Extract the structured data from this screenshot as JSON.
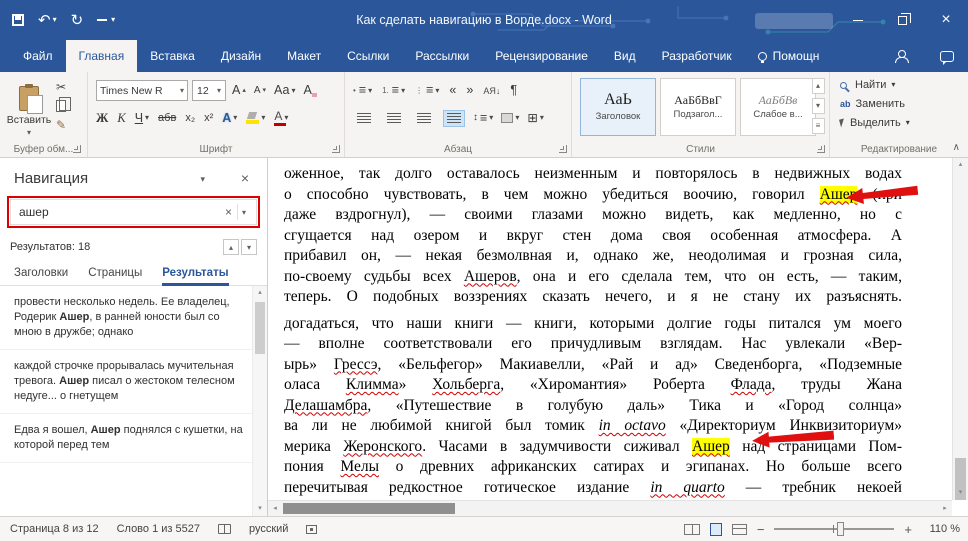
{
  "icons": {
    "dropdown": "▾",
    "undo": "↶",
    "redo": "↻",
    "close": "×",
    "cut": "✂",
    "brush": "✎",
    "pilcrow": "¶",
    "list": "≡",
    "outdent": "«",
    "indent": "»",
    "sort": "АЯ↓",
    "updown": "↕",
    "borders": "⊞",
    "up": "▴",
    "down": "▾",
    "left": "◂",
    "right": "▸",
    "collapse": "∧",
    "clear_x": "×",
    "zoom_out": "−",
    "zoom_in": "+"
  },
  "title_bar": {
    "title": "Как сделать навигацию в Ворде.docx - Word"
  },
  "ribbon": {
    "tabs": [
      {
        "label": "Файл",
        "active": false
      },
      {
        "label": "Главная",
        "active": true
      },
      {
        "label": "Вставка",
        "active": false
      },
      {
        "label": "Дизайн",
        "active": false
      },
      {
        "label": "Макет",
        "active": false
      },
      {
        "label": "Ссылки",
        "active": false
      },
      {
        "label": "Рассылки",
        "active": false
      },
      {
        "label": "Рецензирование",
        "active": false
      },
      {
        "label": "Вид",
        "active": false
      },
      {
        "label": "Разработчик",
        "active": false
      },
      {
        "label": "Помощн",
        "active": false,
        "assistant": true
      }
    ],
    "clipboard": {
      "label": "Буфер обм...",
      "paste": "Вставить"
    },
    "font": {
      "label": "Шрифт",
      "name": "Times New R",
      "size": "12",
      "grow": "А",
      "shrink": "А",
      "case_btn": "Аа",
      "clear": "А",
      "bold": "Ж",
      "italic": "К",
      "underline": "Ч",
      "strike": "абв",
      "subscript": "х₂",
      "superscript": "х²",
      "effects": "А",
      "color": "А"
    },
    "paragraph": {
      "label": "Абзац"
    },
    "styles": {
      "label": "Стили",
      "items": [
        {
          "preview": "АаЬ",
          "name": "Заголовок"
        },
        {
          "preview": "АаБбВвГ",
          "name": "Подзагол..."
        },
        {
          "preview": "АаБбВв",
          "name": "Слабое в..."
        }
      ]
    },
    "editing": {
      "label": "Редактирование",
      "find": "Найти",
      "replace": "Заменить",
      "select": "Выделить"
    }
  },
  "navigation": {
    "title": "Навигация",
    "search_value": "ашер",
    "results_label": "Результатов: 18",
    "tabs": [
      {
        "label": "Заголовки",
        "active": false
      },
      {
        "label": "Страницы",
        "active": false
      },
      {
        "label": "Результаты",
        "active": true
      }
    ],
    "results": [
      {
        "segments": [
          {
            "t": "провести несколько недель. Ее владелец, Родерик "
          },
          {
            "t": "Ашер",
            "b": true
          },
          {
            "t": ", в ранней юности был со мною в дружбе; однако"
          }
        ]
      },
      {
        "segments": [
          {
            "t": "каждой строчке прорывалась мучительная тревога. "
          },
          {
            "t": "Ашер",
            "b": true
          },
          {
            "t": " писал о жестоком телесном недуге... о гнетущем"
          }
        ]
      },
      {
        "segments": [
          {
            "t": "Едва я вошел, "
          },
          {
            "t": "Ашер",
            "b": true
          },
          {
            "t": " поднялся с кушетки, на которой перед тем"
          }
        ]
      }
    ]
  },
  "document": {
    "lines": [
      {
        "segments": [
          {
            "t": "оженное, так долго оставалось неизменным и повторялось в недвижных водах"
          }
        ]
      },
      {
        "segments": [
          {
            "t": "о способно чувствовать, в чем можно убедиться воочию, говорил "
          },
          {
            "t": "Ашер",
            "h": true,
            "u": true
          },
          {
            "t": " (при"
          }
        ]
      },
      {
        "segments": [
          {
            "t": "даже вздрогнул), — своими глазами можно видеть, как медленно, но с"
          }
        ]
      },
      {
        "segments": [
          {
            "t": "сгущается над озером и вкруг стен дома своя особенная атмосфера. А"
          }
        ]
      },
      {
        "segments": [
          {
            "t": "прибавил он, — некая безмолвная и, однако же, неодолимая и грозная сила,"
          }
        ]
      },
      {
        "segments": [
          {
            "t": "по-своему судьбы всех "
          },
          {
            "t": "Ашеров",
            "u": true
          },
          {
            "t": ", она и его сделала тем, что он есть, — таким,"
          }
        ]
      },
      {
        "segments": [
          {
            "t": "теперь. О подобных воззрениях сказать нечего, и я не стану их разъяснять."
          }
        ]
      },
      {
        "para": true,
        "segments": [
          {
            "t": "догадаться, что наши книги — книги, которыми долгие годы питался ум моего"
          }
        ]
      },
      {
        "segments": [
          {
            "t": "— вполне соответствовали его причудливым взглядам. Нас увлекали «Вер-"
          }
        ]
      },
      {
        "segments": [
          {
            "t": "ырь» "
          },
          {
            "t": "Грессэ",
            "u": true
          },
          {
            "t": ", «Бельфегор» Макиавелли, «Рай и ад» Сведенборга, «Подземные"
          }
        ]
      },
      {
        "segments": [
          {
            "t": "оласа "
          },
          {
            "t": "Климма",
            "u": true
          },
          {
            "t": "» "
          },
          {
            "t": "Хольберга",
            "u": true
          },
          {
            "t": ", «Хиромантия» Роберта "
          },
          {
            "t": "Флада",
            "u": true
          },
          {
            "t": ", труды Жана"
          }
        ]
      },
      {
        "segments": [
          {
            "t": "Делашамбра",
            "u": true
          },
          {
            "t": ", «Путешествие в голубую даль» Тика и «Город солнца»"
          }
        ]
      },
      {
        "segments": [
          {
            "t": "ва ли не любимой книгой был томик "
          },
          {
            "t": "in octavo",
            "em": true,
            "u": true
          },
          {
            "t": " «Директориум Инквизиториум»"
          }
        ]
      },
      {
        "segments": [
          {
            "t": "мерика "
          },
          {
            "t": "Жеронского",
            "u": true
          },
          {
            "t": ". Часами в задумчивости сиживал "
          },
          {
            "t": "Ашер",
            "h": true,
            "u": true
          },
          {
            "t": " над страницами Пом-"
          }
        ]
      },
      {
        "segments": [
          {
            "t": "пония "
          },
          {
            "t": "Мелы",
            "u": true
          },
          {
            "t": " о древних африканских сатирах и эгипанах. Но больше всего"
          }
        ]
      },
      {
        "segments": [
          {
            "t": "перечитывая редкостное готическое издание "
          },
          {
            "t": "in quarto",
            "em": true,
            "u": true
          },
          {
            "t": " — требник некоей"
          }
        ]
      }
    ]
  },
  "status_bar": {
    "page": "Страница 8 из 12",
    "words": "Слово 1 из 5527",
    "language": "русский",
    "zoom": "110 %"
  },
  "annotations": {
    "highlight_color": "#ffff00",
    "arrow_color": "#e01010",
    "box_color": "#dd0000"
  }
}
